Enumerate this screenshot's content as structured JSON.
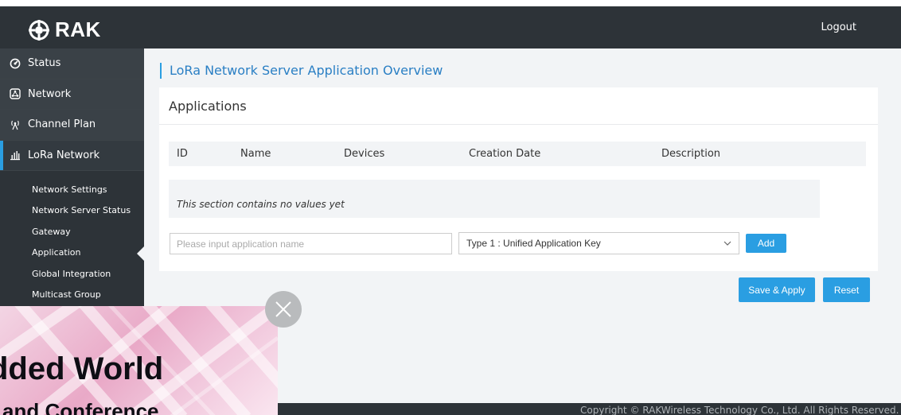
{
  "header": {
    "brand": "RAK",
    "logout_label": "Logout"
  },
  "sidebar": {
    "items": [
      {
        "label": "Status",
        "icon": "gauge-icon"
      },
      {
        "label": "Network",
        "icon": "network-icon"
      },
      {
        "label": "Channel Plan",
        "icon": "antenna-icon"
      },
      {
        "label": "LoRa Network",
        "icon": "signal-bars-icon",
        "active": true
      }
    ],
    "sub_items": [
      {
        "label": "Network Settings"
      },
      {
        "label": "Network Server Status"
      },
      {
        "label": "Gateway"
      },
      {
        "label": "Application",
        "active": true
      },
      {
        "label": "Global Integration"
      },
      {
        "label": "Multicast Group"
      }
    ]
  },
  "main": {
    "page_title": "LoRa Network Server Application Overview",
    "card_title": "Applications",
    "table": {
      "headers": [
        "ID",
        "Name",
        "Devices",
        "Creation Date",
        "Description"
      ],
      "empty_text": "This section contains no values yet"
    },
    "app_name_placeholder": "Please input application name",
    "key_type_selected": "Type 1 : Unified Application Key",
    "add_label": "Add",
    "save_label": "Save & Apply",
    "reset_label": "Reset"
  },
  "footer": {
    "copyright": "Copyright © RAKWireless Technology Co., Ltd. All Rights Reserved."
  },
  "ad": {
    "title": "dded World",
    "subtitle": "and Conference"
  },
  "colors": {
    "accent": "#2a9ee2",
    "title": "#2a7fc4",
    "dark": "#2d3338",
    "page_bg": "#f2f4f6"
  }
}
